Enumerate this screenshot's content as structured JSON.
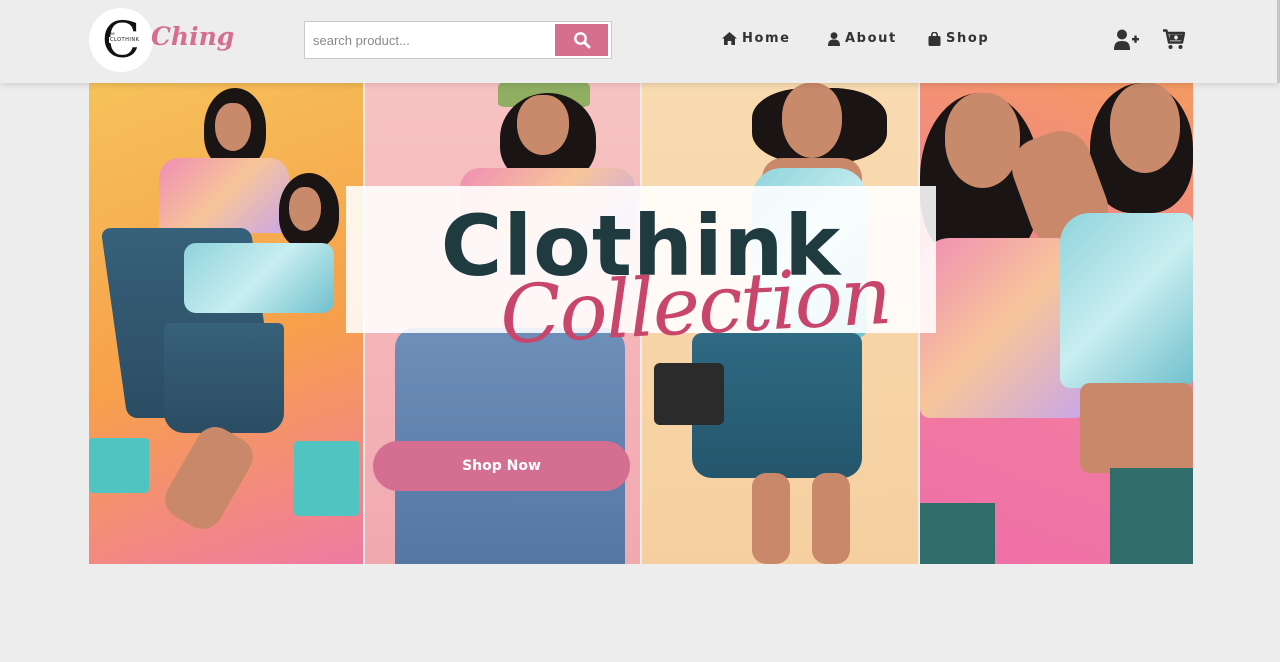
{
  "brand": {
    "logo_letter": "C",
    "logo_mini_top": "the",
    "logo_mini_text": "CLOTHINK",
    "logo_script": "Ching",
    "accent": "#d66f8f"
  },
  "search": {
    "placeholder": "search product...",
    "value": "",
    "button_icon": "search-icon"
  },
  "nav": {
    "items": [
      {
        "label": "Home",
        "icon": "home-icon"
      },
      {
        "label": "About",
        "icon": "user-icon"
      },
      {
        "label": "Shop",
        "icon": "shopping-bag-icon"
      }
    ]
  },
  "header_actions": {
    "register_icon": "user-plus-icon",
    "cart_icon": "cart-icon"
  },
  "hero": {
    "headline": "Clothink",
    "script": "Collection",
    "cta_label": "Shop Now",
    "headline_color": "#1f3b40",
    "script_color": "#c8466b",
    "cta_color": "#d56f92"
  }
}
